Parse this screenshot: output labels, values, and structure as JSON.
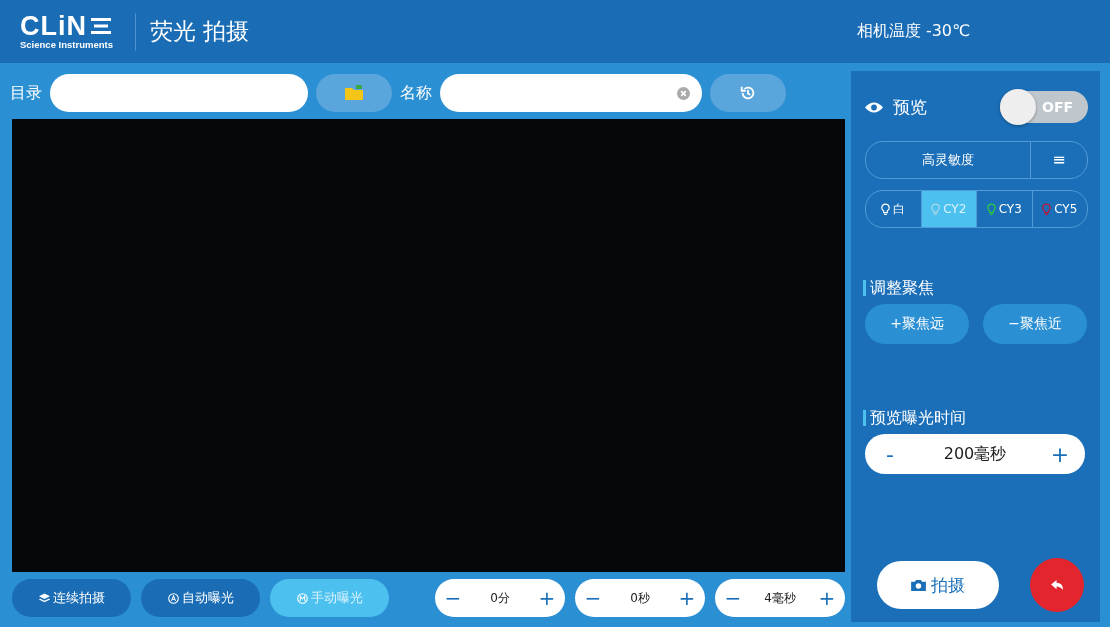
{
  "header": {
    "logo": "CLiN",
    "logo_sub": "Science Instruments",
    "title": "荧光 拍摄",
    "camera_temp": "相机温度 -30℃"
  },
  "toolbar": {
    "directory_label": "目录",
    "name_label": "名称"
  },
  "preview": {
    "label": "预览",
    "on": false,
    "switch_text": "OFF"
  },
  "sensitivity": {
    "label": "高灵敏度",
    "menu": "≡"
  },
  "channels": [
    {
      "label": "白",
      "color": "#ffffff",
      "selected": false
    },
    {
      "label": "CY2",
      "color": "#a8d8e8",
      "selected": true
    },
    {
      "label": "CY3",
      "color": "#2ecc40",
      "selected": false
    },
    {
      "label": "CY5",
      "color": "#c0143c",
      "selected": false
    }
  ],
  "focus": {
    "title": "调整聚焦",
    "far": "+聚焦远",
    "near": "−聚焦近"
  },
  "exposure": {
    "title": "预览曝光时间",
    "minus": "-",
    "value": "200毫秒",
    "plus": "+"
  },
  "capture": "拍摄",
  "modes": [
    {
      "label": "连续拍摄",
      "kind": "layers",
      "selected": false
    },
    {
      "label": "自动曝光",
      "kind": "auto",
      "selected": false
    },
    {
      "label": "手动曝光",
      "kind": "manual",
      "selected": true
    }
  ],
  "steppers": [
    {
      "minus": "−",
      "value": "0分",
      "plus": "+"
    },
    {
      "minus": "−",
      "value": "0秒",
      "plus": "+"
    },
    {
      "minus": "−",
      "value": "4毫秒",
      "plus": "+"
    }
  ]
}
